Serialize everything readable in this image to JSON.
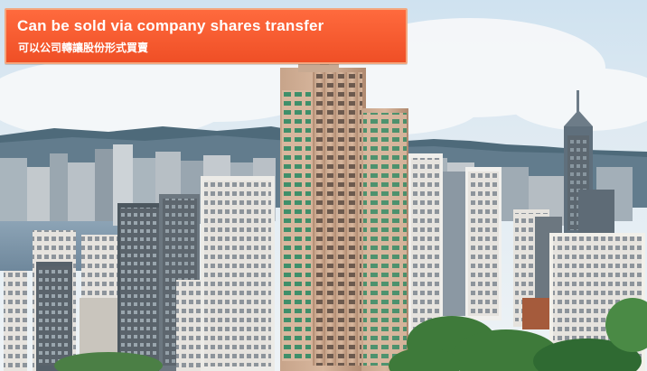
{
  "banner": {
    "title": "Can be sold via company shares transfer",
    "subtitle": "可以公司轉讓股份形式買賣"
  }
}
